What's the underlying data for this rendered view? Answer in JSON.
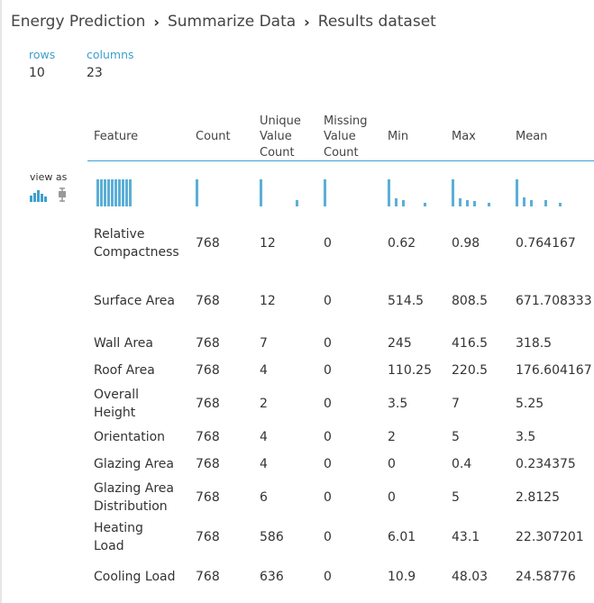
{
  "breadcrumb": {
    "items": [
      "Energy Prediction",
      "Summarize Data",
      "Results dataset"
    ],
    "separator": "›"
  },
  "meta": {
    "rows_label": "rows",
    "rows_value": "10",
    "columns_label": "columns",
    "columns_value": "23"
  },
  "view_as_label": "view as",
  "columns": [
    [
      "Feature"
    ],
    [
      "Count"
    ],
    [
      "Unique",
      "Value",
      "Count"
    ],
    [
      "Missing",
      "Value",
      "Count"
    ],
    [
      "Min"
    ],
    [
      "Max"
    ],
    [
      "Mean"
    ]
  ],
  "rows": [
    {
      "feature": [
        "Relative",
        "Compactness"
      ],
      "count": "768",
      "unique": "12",
      "missing": "0",
      "min": "0.62",
      "max": "0.98",
      "mean": "0.764167"
    },
    {
      "feature": [
        "Surface Area"
      ],
      "count": "768",
      "unique": "12",
      "missing": "0",
      "min": "514.5",
      "max": "808.5",
      "mean": "671.708333"
    },
    {
      "feature": [
        "Wall Area"
      ],
      "count": "768",
      "unique": "7",
      "missing": "0",
      "min": "245",
      "max": "416.5",
      "mean": "318.5"
    },
    {
      "feature": [
        "Roof Area"
      ],
      "count": "768",
      "unique": "4",
      "missing": "0",
      "min": "110.25",
      "max": "220.5",
      "mean": "176.604167"
    },
    {
      "feature": [
        "Overall",
        "Height"
      ],
      "count": "768",
      "unique": "2",
      "missing": "0",
      "min": "3.5",
      "max": "7",
      "mean": "5.25"
    },
    {
      "feature": [
        "Orientation"
      ],
      "count": "768",
      "unique": "4",
      "missing": "0",
      "min": "2",
      "max": "5",
      "mean": "3.5"
    },
    {
      "feature": [
        "Glazing Area"
      ],
      "count": "768",
      "unique": "4",
      "missing": "0",
      "min": "0",
      "max": "0.4",
      "mean": "0.234375"
    },
    {
      "feature": [
        "Glazing Area",
        "Distribution"
      ],
      "count": "768",
      "unique": "6",
      "missing": "0",
      "min": "0",
      "max": "5",
      "mean": "2.8125"
    },
    {
      "feature": [
        "Heating",
        "Load"
      ],
      "count": "768",
      "unique": "586",
      "missing": "0",
      "min": "6.01",
      "max": "43.1",
      "mean": "22.307201"
    },
    {
      "feature": [
        "Cooling Load"
      ],
      "count": "768",
      "unique": "636",
      "missing": "0",
      "min": "10.9",
      "max": "48.03",
      "mean": "24.58776"
    }
  ],
  "column_histograms": {
    "feature": [
      1,
      1,
      1,
      1,
      1,
      1,
      1,
      1,
      1,
      1
    ],
    "count": [
      1
    ],
    "unique": [
      1,
      0,
      0,
      0,
      0,
      0.25
    ],
    "missing": [
      1
    ],
    "min": [
      1,
      0.3,
      0.25,
      0,
      0,
      0.15
    ],
    "max": [
      1,
      0.3,
      0.25,
      0.2,
      0,
      0.15
    ],
    "mean": [
      1,
      0.35,
      0.25,
      0,
      0.25,
      0,
      0.15
    ]
  },
  "colors": {
    "accent": "#3f9fce",
    "bar": "#5aafd6"
  }
}
